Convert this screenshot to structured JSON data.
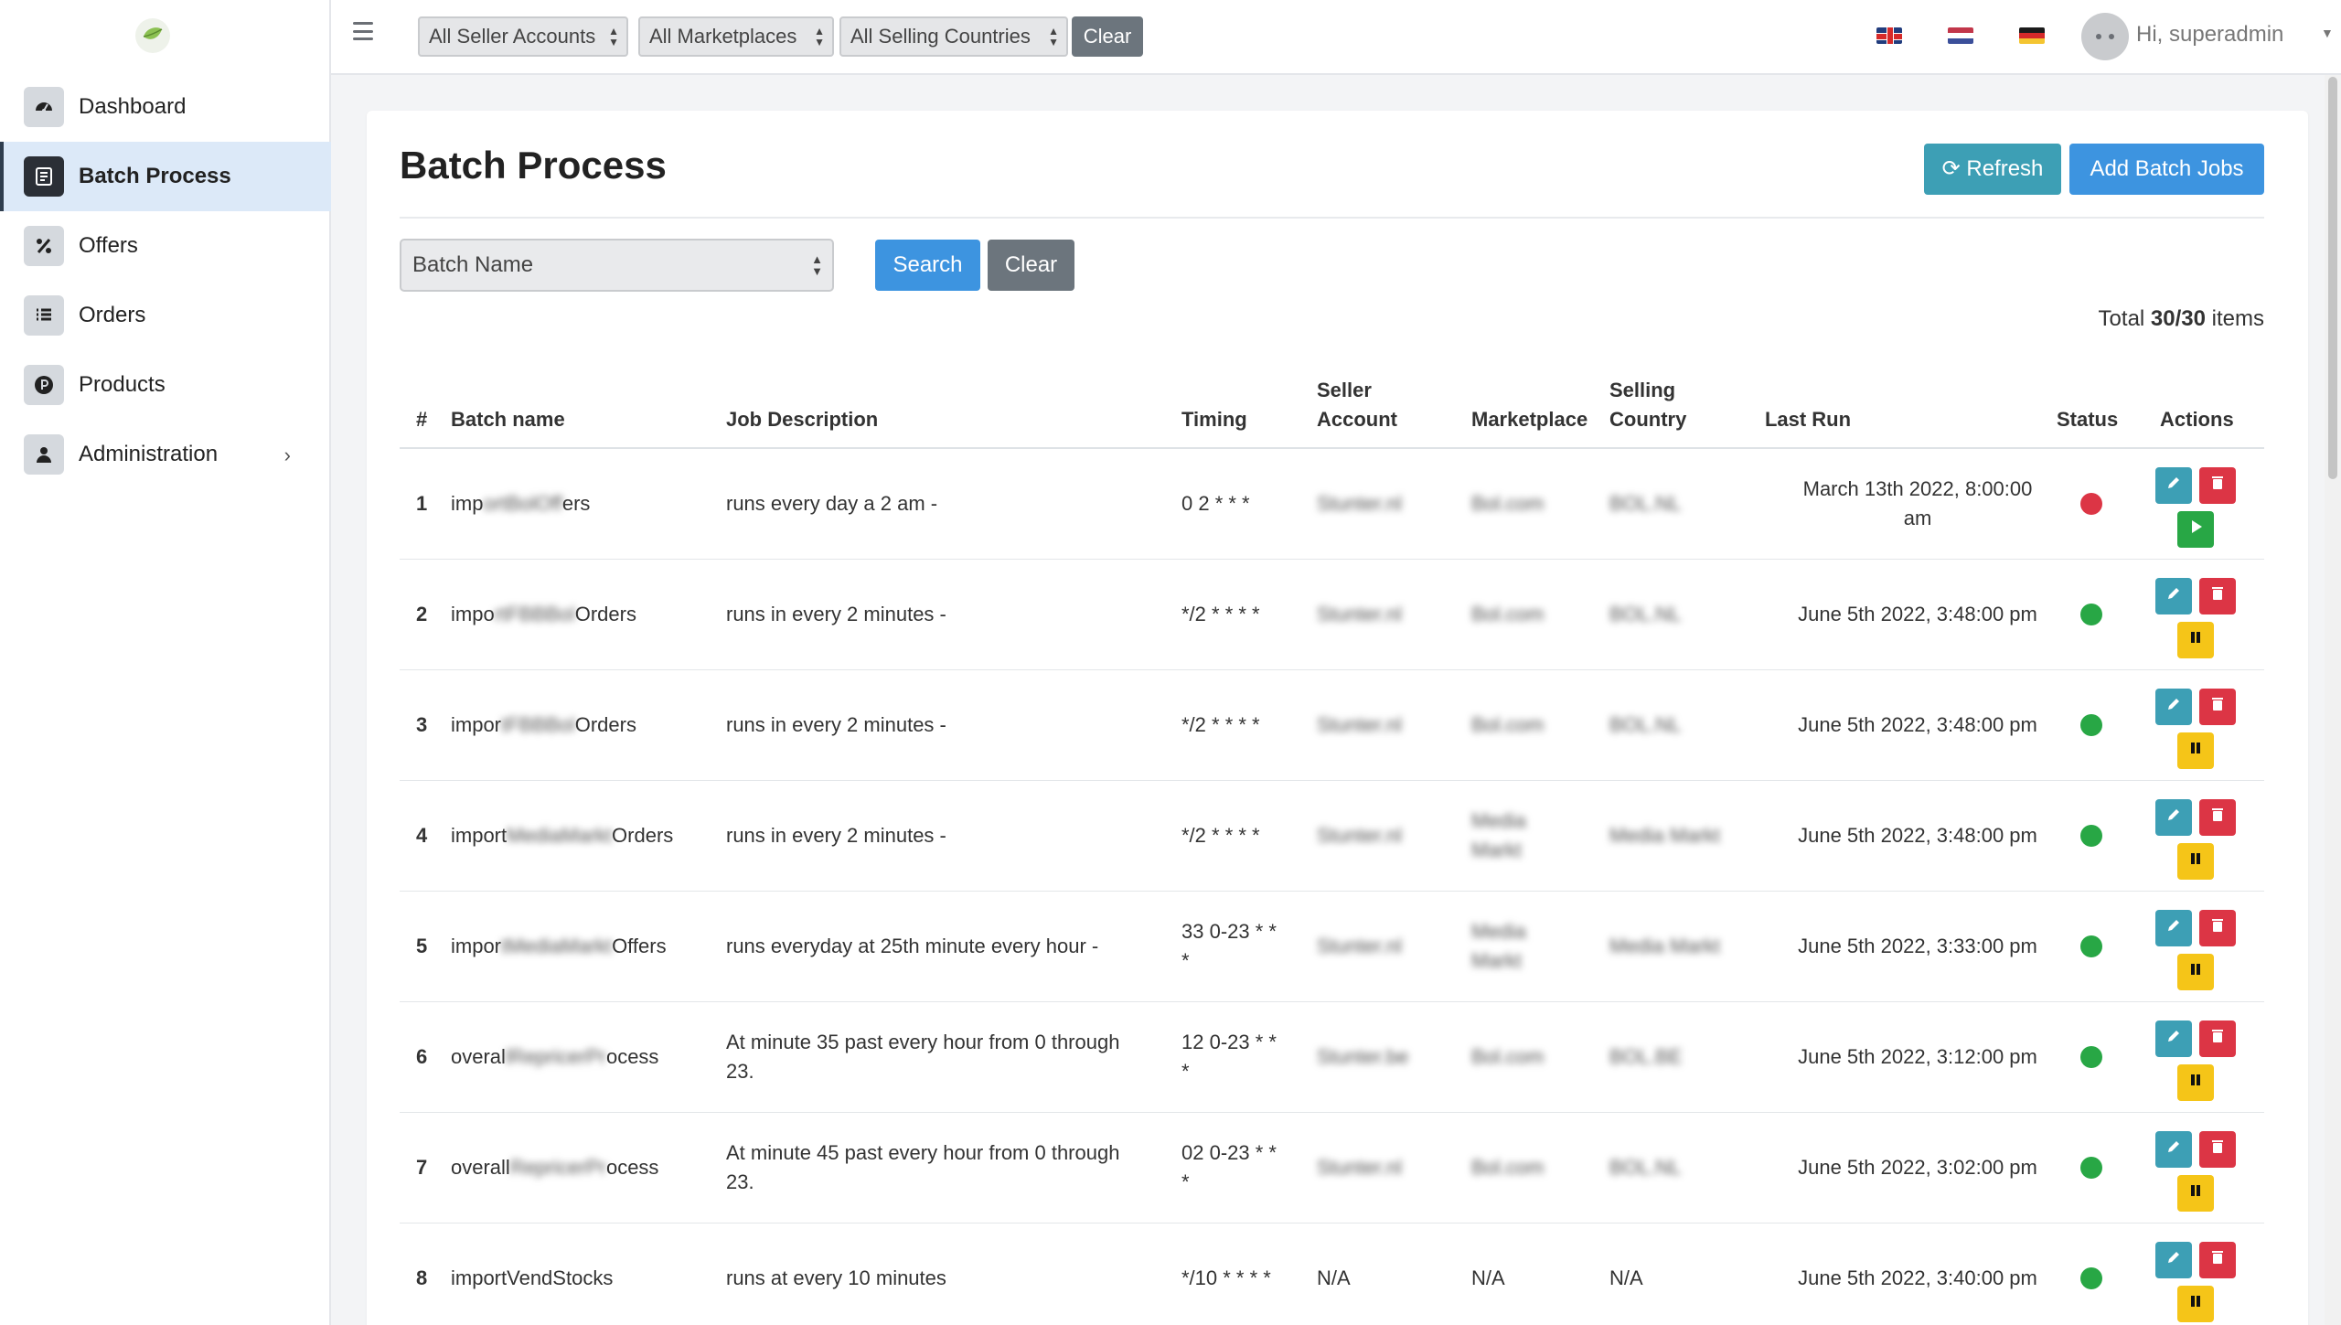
{
  "sidebar": {
    "items": [
      {
        "label": "Dashboard",
        "icon": "dashboard-gauge-icon"
      },
      {
        "label": "Batch Process",
        "icon": "batch-process-icon",
        "active": true
      },
      {
        "label": "Offers",
        "icon": "percent-icon"
      },
      {
        "label": "Orders",
        "icon": "list-icon"
      },
      {
        "label": "Products",
        "icon": "p-circle-icon"
      },
      {
        "label": "Administration",
        "icon": "user-icon",
        "has_submenu": true
      }
    ]
  },
  "topbar": {
    "filters": [
      "All Seller Accounts",
      "All Marketplaces",
      "All Selling Countries"
    ],
    "clear_label": "Clear",
    "languages": [
      "uk-flag",
      "nl-flag",
      "de-flag"
    ],
    "greeting": "Hi, superadmin"
  },
  "page": {
    "title": "Batch Process",
    "refresh_label": "Refresh",
    "add_label": "Add Batch Jobs",
    "filter_select": "Batch Name",
    "search_label": "Search",
    "clear_label": "Clear",
    "total_prefix": "Total",
    "total_value": "30/30",
    "total_suffix": "items"
  },
  "table": {
    "headers": {
      "num": "#",
      "name": "Batch name",
      "desc": "Job Description",
      "timing": "Timing",
      "seller_1": "Seller",
      "seller_2": "Account",
      "marketplace": "Marketplace",
      "country_1": "Selling",
      "country_2": "Country",
      "last_run": "Last Run",
      "status": "Status",
      "actions": "Actions"
    },
    "rows": [
      {
        "num": "1",
        "name_pre": "imp",
        "name_mid": "ortBolOff",
        "name_post": "ers",
        "desc_1": "runs every day a 2 am -",
        "desc_2": "",
        "timing_1": "0 2 * * *",
        "timing_2": "",
        "seller": "Stunter.nl",
        "market_1": "Bol.com",
        "market_2": "",
        "country": "BOL.NL",
        "last_1": "March 13th 2022, 8:00:00",
        "last_2": "am",
        "status": "error",
        "running": false
      },
      {
        "num": "2",
        "name_pre": "impo",
        "name_mid": "rtFBBBol",
        "name_post": "Orders",
        "desc_1": "runs in every 2 minutes -",
        "desc_2": "",
        "timing_1": "*/2 * * * *",
        "timing_2": "",
        "seller": "Stunter.nl",
        "market_1": "Bol.com",
        "market_2": "",
        "country": "BOL.NL",
        "last_1": "June 5th 2022, 3:48:00 pm",
        "last_2": "",
        "status": "ok",
        "running": true
      },
      {
        "num": "3",
        "name_pre": "impor",
        "name_mid": "tFBBBol",
        "name_post": "Orders",
        "desc_1": "runs in every 2 minutes -",
        "desc_2": "",
        "timing_1": "*/2 * * * *",
        "timing_2": "",
        "seller": "Stunter.nl",
        "market_1": "Bol.com",
        "market_2": "",
        "country": "BOL.NL",
        "last_1": "June 5th 2022, 3:48:00 pm",
        "last_2": "",
        "status": "ok",
        "running": true
      },
      {
        "num": "4",
        "name_pre": "import",
        "name_mid": "MediaMarkt",
        "name_post": "Orders",
        "desc_1": "runs in every 2 minutes -",
        "desc_2": "",
        "timing_1": "*/2 * * * *",
        "timing_2": "",
        "seller": "Stunter.nl",
        "market_1": "Media",
        "market_2": "Markt",
        "country": "Media Markt",
        "last_1": "June 5th 2022, 3:48:00 pm",
        "last_2": "",
        "status": "ok",
        "running": true
      },
      {
        "num": "5",
        "name_pre": "impor",
        "name_mid": "tMediaMarkt",
        "name_post": "Offers",
        "desc_1": "runs everyday at 25th minute every hour -",
        "desc_2": "",
        "timing_1": "33 0-23 * *",
        "timing_2": "*",
        "seller": "Stunter.nl",
        "market_1": "Media",
        "market_2": "Markt",
        "country": "Media Markt",
        "last_1": "June 5th 2022, 3:33:00 pm",
        "last_2": "",
        "status": "ok",
        "running": true
      },
      {
        "num": "6",
        "name_pre": "overal",
        "name_mid": "lRepricerPr",
        "name_post": "ocess",
        "desc_1": "At minute 35 past every hour from 0 through",
        "desc_2": "23.",
        "timing_1": "12 0-23 * *",
        "timing_2": "*",
        "seller": "Stunter.be",
        "market_1": "Bol.com",
        "market_2": "",
        "country": "BOL.BE",
        "last_1": "June 5th 2022, 3:12:00 pm",
        "last_2": "",
        "status": "ok",
        "running": true
      },
      {
        "num": "7",
        "name_pre": "overall",
        "name_mid": "RepricerPr",
        "name_post": "ocess",
        "desc_1": "At minute 45 past every hour from 0 through",
        "desc_2": "23.",
        "timing_1": "02 0-23 * *",
        "timing_2": "*",
        "seller": "Stunter.nl",
        "market_1": "Bol.com",
        "market_2": "",
        "country": "BOL.NL",
        "last_1": "June 5th 2022, 3:02:00 pm",
        "last_2": "",
        "status": "ok",
        "running": true
      },
      {
        "num": "8",
        "name_pre": "import",
        "name_mid": "VendStoc",
        "name_post": "ks",
        "desc_1": "runs at every 10 minutes",
        "desc_2": "",
        "timing_1": "*/10 * * * *",
        "timing_2": "",
        "seller": "N/A",
        "market_1": "N/A",
        "market_2": "",
        "country": "N/A",
        "last_1": "June 5th 2022, 3:40:00 pm",
        "last_2": "",
        "status": "ok",
        "running": true,
        "plain": true
      }
    ]
  },
  "colors": {
    "status_ok": "#28a745",
    "status_error": "#dc3545",
    "primary": "#3d94e0",
    "info": "#3d9fb5"
  }
}
